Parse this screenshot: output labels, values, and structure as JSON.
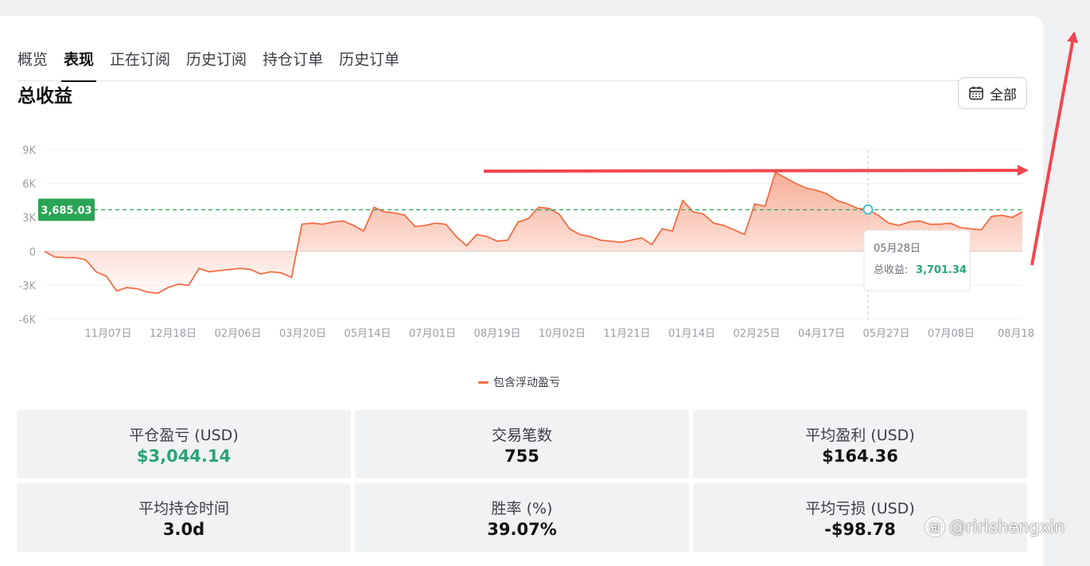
{
  "tabs": [
    {
      "label": "概览",
      "active": false
    },
    {
      "label": "表现",
      "active": true
    },
    {
      "label": "正在订阅",
      "active": false
    },
    {
      "label": "历史订阅",
      "active": false
    },
    {
      "label": "持仓订单",
      "active": false
    },
    {
      "label": "历史订单",
      "active": false
    }
  ],
  "section_title": "总收益",
  "range_button": {
    "label": "全部",
    "icon": "calendar-icon"
  },
  "chart_data": {
    "type": "area",
    "x_ticks": [
      "11月07日",
      "12月18日",
      "02月06日",
      "03月20日",
      "05月14日",
      "07月01日",
      "08月19日",
      "10月02日",
      "11月21日",
      "01月14日",
      "02月25日",
      "04月17日",
      "05月27日",
      "07月08日",
      "08月18"
    ],
    "y_ticks": [
      "9K",
      "6K",
      "3K",
      "0",
      "-3K",
      "-6K"
    ],
    "ylim": [
      -6000,
      9000
    ],
    "series": [
      {
        "name": "包含浮动盈亏",
        "color": "#f26d44",
        "values": [
          0,
          -500,
          -550,
          -550,
          -750,
          -1800,
          -2200,
          -3500,
          -3200,
          -3300,
          -3600,
          -3700,
          -3200,
          -2900,
          -3000,
          -1500,
          -1800,
          -1700,
          -1600,
          -1500,
          -1600,
          -2000,
          -1800,
          -1900,
          -2300,
          2400,
          2500,
          2400,
          2600,
          2700,
          2300,
          1800,
          3900,
          3500,
          3400,
          3200,
          2200,
          2300,
          2500,
          2400,
          1300,
          500,
          1500,
          1300,
          900,
          1000,
          2600,
          2900,
          3900,
          3800,
          3300,
          2000,
          1500,
          1300,
          1000,
          900,
          800,
          1000,
          1200,
          600,
          2000,
          1800,
          4500,
          3500,
          3300,
          2500,
          2300,
          1900,
          1500,
          4200,
          4000,
          7000,
          6500,
          6000,
          5600,
          5400,
          5100,
          4500,
          4200,
          3800,
          3701,
          3200,
          2500,
          2300,
          2600,
          2700,
          2400,
          2400,
          2500,
          2100,
          2000,
          1900,
          3100,
          3200,
          3000,
          3500
        ]
      }
    ],
    "reference_line": {
      "value": 3685.03,
      "label": "3,685.03",
      "color": "#2aa455"
    },
    "tooltip": {
      "date": "05月28日",
      "label": "总收益:",
      "value": "3,701.34",
      "index": 80
    }
  },
  "stats": [
    {
      "label": "平仓盈亏 (USD)",
      "value": "$3,044.14",
      "positive": true
    },
    {
      "label": "交易笔数",
      "value": "755",
      "positive": false
    },
    {
      "label": "平均盈利 (USD)",
      "value": "$164.36",
      "positive": false
    },
    {
      "label": "平均持仓时间",
      "value": "3.0d",
      "positive": false
    },
    {
      "label": "胜率 (%)",
      "value": "39.07%",
      "positive": false
    },
    {
      "label": "平均亏损 (USD)",
      "value": "-$98.78",
      "positive": false
    }
  ],
  "watermark": {
    "text": "@ririshengxin",
    "icon": "zhihu-logo-icon"
  },
  "annotation_color": "#f0474e"
}
